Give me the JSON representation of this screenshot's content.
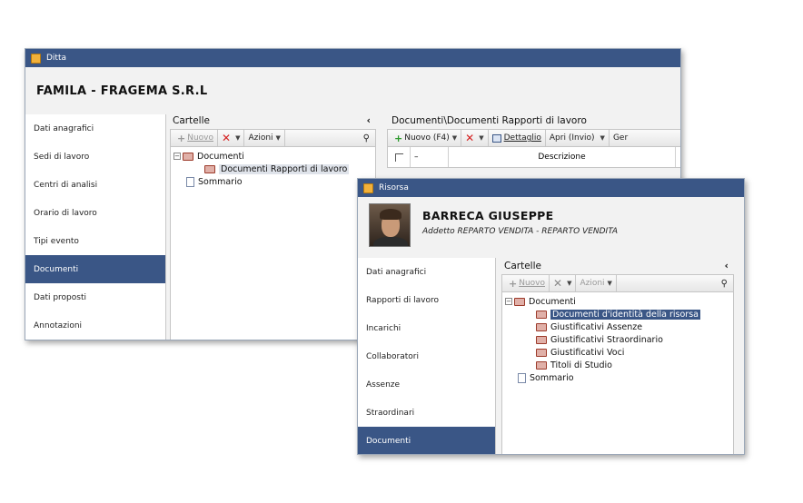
{
  "ditta": {
    "title": "Ditta",
    "company": "FAMILA - FRAGEMA S.R.L",
    "sidebar": [
      "Dati anagrafici",
      "Sedi di lavoro",
      "Centri di analisi",
      "Orario di lavoro",
      "Tipi evento",
      "Documenti",
      "Dati proposti",
      "Annotazioni"
    ],
    "active_index": 5,
    "cartelle": {
      "title": "Cartelle",
      "collapse": "‹",
      "toolbar": {
        "nuovo": "Nuovo",
        "azioni": "Azioni"
      },
      "tree": [
        "Documenti",
        "Documenti Rapporti di lavoro",
        "Sommario"
      ]
    },
    "right_panel": {
      "title": "Documenti\\Documenti Rapporti di lavoro",
      "toolbar": {
        "nuovo": "Nuovo (F4)",
        "dettaglio": "Dettaglio",
        "apri": "Apri (Invio)",
        "more": "Ger"
      },
      "column": "Descrizione"
    }
  },
  "risorsa": {
    "title": "Risorsa",
    "name": "BARRECA GIUSEPPE",
    "subtitle": "Addetto REPARTO VENDITA - REPARTO VENDITA",
    "sidebar": [
      "Dati anagrafici",
      "Rapporti di lavoro",
      "Incarichi",
      "Collaboratori",
      "Assenze",
      "Straordinari",
      "Documenti"
    ],
    "active_index": 6,
    "cartelle": {
      "title": "Cartelle",
      "collapse": "‹",
      "toolbar": {
        "nuovo": "Nuovo",
        "azioni": "Azioni"
      },
      "tree": [
        "Documenti",
        "Documenti d'identità della risorsa",
        "Giustificativi Assenze",
        "Giustificativi Straordinario",
        "Giustificativi Voci",
        "Titoli di Studio",
        "Sommario"
      ]
    }
  },
  "colors": {
    "titlebar": "#3a5686",
    "active": "#3a5686",
    "add": "#2e9b2e",
    "delete": "#d52222"
  }
}
